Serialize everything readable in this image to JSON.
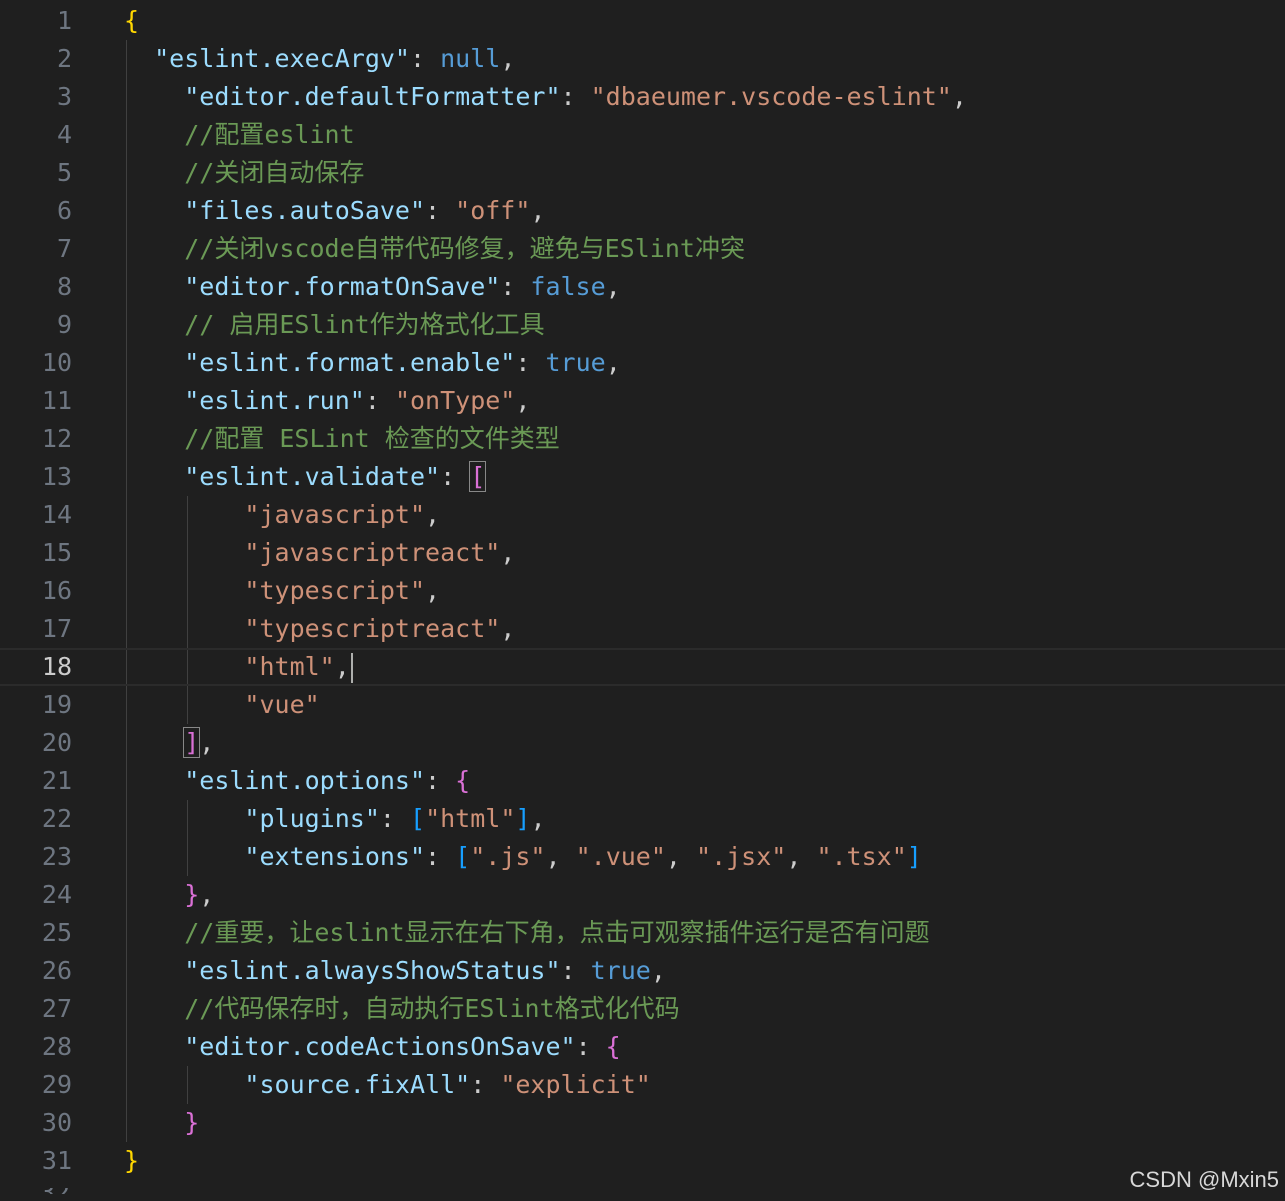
{
  "editor": {
    "lines": [
      {
        "n": "1",
        "t": [
          [
            "b1",
            "{"
          ]
        ]
      },
      {
        "n": "2",
        "t": [
          [
            "sp",
            "  "
          ],
          [
            "key",
            "\"eslint.execArgv\""
          ],
          [
            "p",
            ": "
          ],
          [
            "kw",
            "null"
          ],
          [
            "p",
            ","
          ]
        ]
      },
      {
        "n": "3",
        "t": [
          [
            "sp",
            "    "
          ],
          [
            "key",
            "\"editor.defaultFormatter\""
          ],
          [
            "p",
            ": "
          ],
          [
            "str",
            "\"dbaeumer.vscode-eslint\""
          ],
          [
            "p",
            ","
          ]
        ]
      },
      {
        "n": "4",
        "t": [
          [
            "sp",
            "    "
          ],
          [
            "com",
            "//配置eslint"
          ]
        ]
      },
      {
        "n": "5",
        "t": [
          [
            "sp",
            "    "
          ],
          [
            "com",
            "//关闭自动保存"
          ]
        ]
      },
      {
        "n": "6",
        "t": [
          [
            "sp",
            "    "
          ],
          [
            "key",
            "\"files.autoSave\""
          ],
          [
            "p",
            ": "
          ],
          [
            "str",
            "\"off\""
          ],
          [
            "p",
            ","
          ]
        ]
      },
      {
        "n": "7",
        "t": [
          [
            "sp",
            "    "
          ],
          [
            "com",
            "//关闭vscode自带代码修复，避免与ESlint冲突"
          ]
        ]
      },
      {
        "n": "8",
        "t": [
          [
            "sp",
            "    "
          ],
          [
            "key",
            "\"editor.formatOnSave\""
          ],
          [
            "p",
            ": "
          ],
          [
            "kw",
            "false"
          ],
          [
            "p",
            ","
          ]
        ]
      },
      {
        "n": "9",
        "t": [
          [
            "sp",
            "    "
          ],
          [
            "com",
            "// 启用ESlint作为格式化工具"
          ]
        ]
      },
      {
        "n": "10",
        "t": [
          [
            "sp",
            "    "
          ],
          [
            "key",
            "\"eslint.format.enable\""
          ],
          [
            "p",
            ": "
          ],
          [
            "kw",
            "true"
          ],
          [
            "p",
            ","
          ]
        ]
      },
      {
        "n": "11",
        "t": [
          [
            "sp",
            "    "
          ],
          [
            "key",
            "\"eslint.run\""
          ],
          [
            "p",
            ": "
          ],
          [
            "str",
            "\"onType\""
          ],
          [
            "p",
            ","
          ]
        ]
      },
      {
        "n": "12",
        "t": [
          [
            "sp",
            "    "
          ],
          [
            "com",
            "//配置 ESLint 检查的文件类型"
          ]
        ]
      },
      {
        "n": "13",
        "t": [
          [
            "sp",
            "    "
          ],
          [
            "key",
            "\"eslint.validate\""
          ],
          [
            "p",
            ": "
          ],
          [
            "b2box",
            "["
          ]
        ]
      },
      {
        "n": "14",
        "t": [
          [
            "sp",
            "        "
          ],
          [
            "str",
            "\"javascript\""
          ],
          [
            "p",
            ","
          ]
        ]
      },
      {
        "n": "15",
        "t": [
          [
            "sp",
            "        "
          ],
          [
            "str",
            "\"javascriptreact\""
          ],
          [
            "p",
            ","
          ]
        ]
      },
      {
        "n": "16",
        "t": [
          [
            "sp",
            "        "
          ],
          [
            "str",
            "\"typescript\""
          ],
          [
            "p",
            ","
          ]
        ]
      },
      {
        "n": "17",
        "t": [
          [
            "sp",
            "        "
          ],
          [
            "str",
            "\"typescriptreact\""
          ],
          [
            "p",
            ","
          ]
        ]
      },
      {
        "n": "18",
        "t": [
          [
            "sp",
            "        "
          ],
          [
            "str",
            "\"html\""
          ],
          [
            "p",
            ","
          ],
          [
            "cursor",
            ""
          ]
        ]
      },
      {
        "n": "19",
        "t": [
          [
            "sp",
            "        "
          ],
          [
            "str",
            "\"vue\""
          ]
        ]
      },
      {
        "n": "20",
        "t": [
          [
            "sp",
            "    "
          ],
          [
            "b2box",
            "]"
          ],
          [
            "p",
            ","
          ]
        ]
      },
      {
        "n": "21",
        "t": [
          [
            "sp",
            "    "
          ],
          [
            "key",
            "\"eslint.options\""
          ],
          [
            "p",
            ": "
          ],
          [
            "b2",
            "{"
          ]
        ]
      },
      {
        "n": "22",
        "t": [
          [
            "sp",
            "        "
          ],
          [
            "key",
            "\"plugins\""
          ],
          [
            "p",
            ": "
          ],
          [
            "b3",
            "["
          ],
          [
            "str",
            "\"html\""
          ],
          [
            "b3",
            "]"
          ],
          [
            "p",
            ","
          ]
        ]
      },
      {
        "n": "23",
        "t": [
          [
            "sp",
            "        "
          ],
          [
            "key",
            "\"extensions\""
          ],
          [
            "p",
            ": "
          ],
          [
            "b3",
            "["
          ],
          [
            "str",
            "\".js\""
          ],
          [
            "p",
            ", "
          ],
          [
            "str",
            "\".vue\""
          ],
          [
            "p",
            ", "
          ],
          [
            "str",
            "\".jsx\""
          ],
          [
            "p",
            ", "
          ],
          [
            "str",
            "\".tsx\""
          ],
          [
            "b3",
            "]"
          ]
        ]
      },
      {
        "n": "24",
        "t": [
          [
            "sp",
            "    "
          ],
          [
            "b2",
            "}"
          ],
          [
            "p",
            ","
          ]
        ]
      },
      {
        "n": "25",
        "t": [
          [
            "sp",
            "    "
          ],
          [
            "com",
            "//重要，让eslint显示在右下角，点击可观察插件运行是否有问题"
          ]
        ]
      },
      {
        "n": "26",
        "t": [
          [
            "sp",
            "    "
          ],
          [
            "key",
            "\"eslint.alwaysShowStatus\""
          ],
          [
            "p",
            ": "
          ],
          [
            "kw",
            "true"
          ],
          [
            "p",
            ","
          ]
        ]
      },
      {
        "n": "27",
        "t": [
          [
            "sp",
            "    "
          ],
          [
            "com",
            "//代码保存时，自动执行ESlint格式化代码"
          ]
        ]
      },
      {
        "n": "28",
        "t": [
          [
            "sp",
            "    "
          ],
          [
            "key",
            "\"editor.codeActionsOnSave\""
          ],
          [
            "p",
            ": "
          ],
          [
            "b2",
            "{"
          ]
        ]
      },
      {
        "n": "29",
        "t": [
          [
            "sp",
            "        "
          ],
          [
            "key",
            "\"source.fixAll\""
          ],
          [
            "p",
            ": "
          ],
          [
            "str",
            "\"explicit\""
          ]
        ]
      },
      {
        "n": "30",
        "t": [
          [
            "sp",
            "    "
          ],
          [
            "b2",
            "}"
          ]
        ]
      },
      {
        "n": "31",
        "t": [
          [
            "b1",
            "}"
          ]
        ]
      }
    ],
    "current_line": "18",
    "partial_line_number": "32"
  },
  "watermark": "CSDN @Mxin5",
  "colors": {
    "background": "#1f1f1f",
    "line_number": "#6e7681",
    "key": "#9cdcfe",
    "string": "#ce9178",
    "keyword": "#569cd6",
    "comment": "#6a9955",
    "bracket_level1": "#ffd700",
    "bracket_level2": "#da70d6",
    "bracket_level3": "#179fff"
  }
}
